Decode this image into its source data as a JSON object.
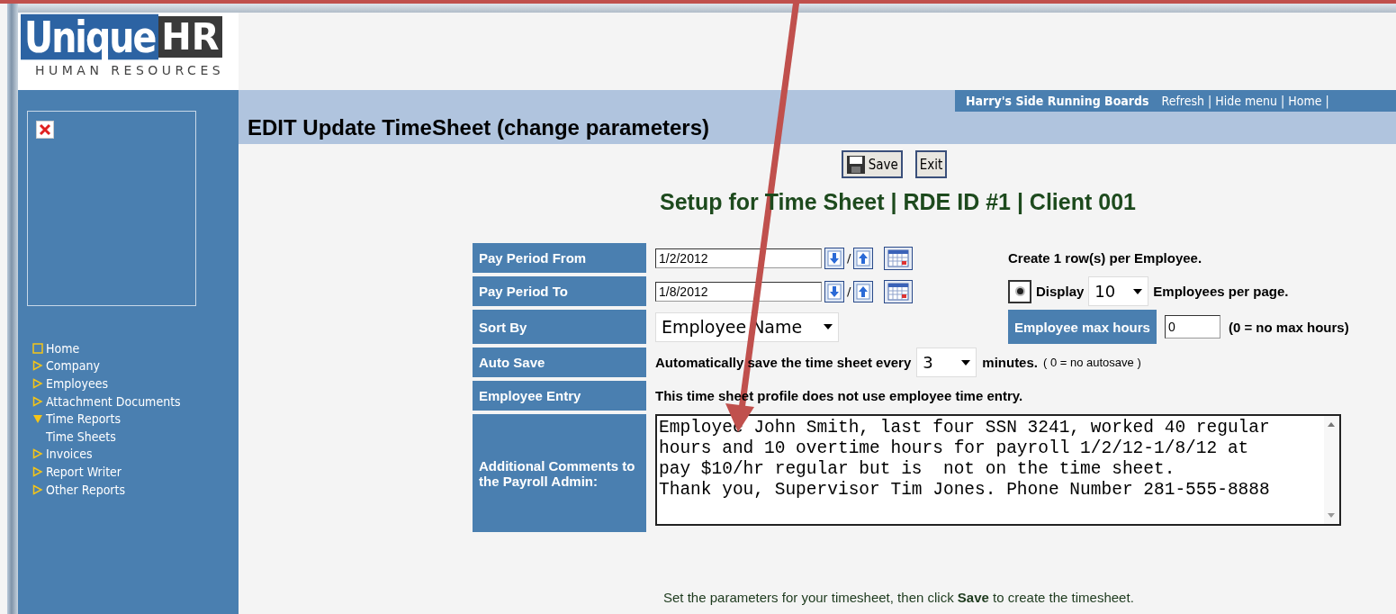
{
  "logo": {
    "word": "Unique",
    "suffix": "HR",
    "tagline": "HUMAN RESOURCES"
  },
  "sidebar": {
    "items": [
      {
        "label": "Home",
        "kind": "page"
      },
      {
        "label": "Company",
        "kind": "folder",
        "expanded": false
      },
      {
        "label": "Employees",
        "kind": "folder",
        "expanded": false
      },
      {
        "label": "Attachment Documents",
        "kind": "folder",
        "expanded": false
      },
      {
        "label": "Time Reports",
        "kind": "folder",
        "expanded": true,
        "children": [
          {
            "label": "Time Sheets"
          }
        ]
      },
      {
        "label": "Invoices",
        "kind": "folder",
        "expanded": false
      },
      {
        "label": "Report Writer",
        "kind": "folder",
        "expanded": false
      },
      {
        "label": "Other Reports",
        "kind": "folder",
        "expanded": false
      }
    ]
  },
  "account": {
    "name": "Harry's Side Running Boards",
    "separator": "|",
    "links": [
      "Refresh",
      "Hide menu",
      "Home"
    ]
  },
  "page_title": "EDIT Update TimeSheet (change parameters)",
  "buttons": [
    {
      "label": "Save",
      "kind": "save"
    },
    {
      "label": "Exit",
      "kind": "plain"
    }
  ],
  "heading": "Setup for Time Sheet | RDE ID #1 | Client 001",
  "form": {
    "rows": [
      {
        "label": "Pay Period From",
        "kind": "date",
        "value": "1/2/2012",
        "icon_separator": "/"
      },
      {
        "label": "Pay Period To",
        "kind": "date",
        "value": "1/8/2012",
        "icon_separator": "/"
      },
      {
        "label": "Sort By",
        "kind": "select",
        "value": "Employee Name"
      },
      {
        "label": "Auto Save",
        "kind": "autosave",
        "before": "Automatically save the time sheet every",
        "value": "3",
        "after": "minutes.",
        "note": "( 0 = no autosave )"
      },
      {
        "label": "Employee Entry",
        "kind": "text",
        "text": "This time sheet profile does not use employee time entry."
      },
      {
        "label": "Additional Comments to the Payroll Admin:",
        "kind": "comments",
        "value": "Employee John Smith, last four SSN 3241, worked 40 regular hours and 10 overtime hours for payroll 1/2/12-1/8/12 at\npay $10/hr regular but is  not on the time sheet.\nThank you, Supervisor Tim Jones. Phone Number 281-555-8888"
      }
    ],
    "options": [
      {
        "kind": "text",
        "text": "Create 1 row(s) per Employee."
      },
      {
        "kind": "display",
        "selected": true,
        "label": "Display",
        "value": "10",
        "after": "Employees per page."
      },
      {
        "kind": "max",
        "label": "Employee max hours",
        "value": "0",
        "note": "(0 = no max hours)"
      }
    ]
  },
  "footer": "Set the parameters for your timesheet, then click **Save** to create the timesheet."
}
